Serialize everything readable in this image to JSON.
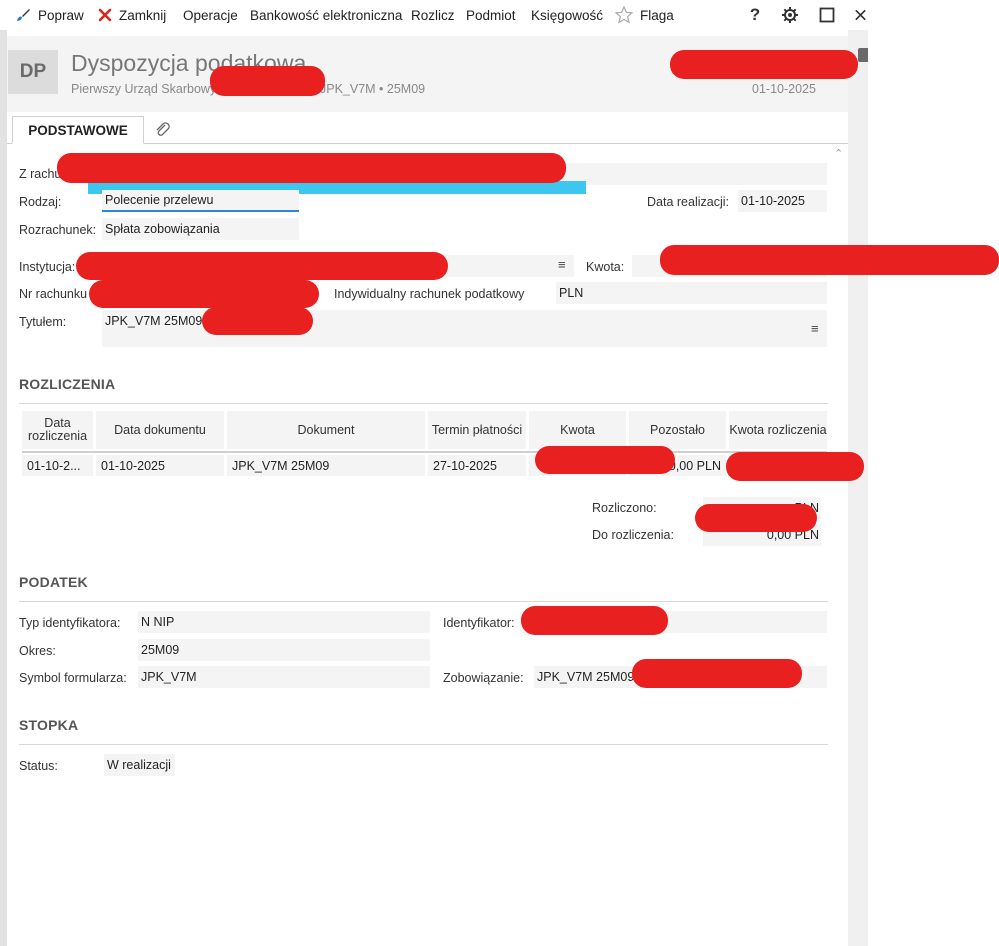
{
  "toolbar": {
    "fix_label": "Popraw",
    "close_label": "Zamknij",
    "operations_label": "Operacje",
    "ebanking_label": "Bankowość elektroniczna",
    "settle_label": "Rozlicz",
    "entity_label": "Podmiot",
    "accounting_label": "Księgowość",
    "flag_label": "Flaga",
    "help_icon": "?",
    "accent_close": "#d9261c"
  },
  "header": {
    "badge": "DP",
    "title": "Dyspozycja podatkowa",
    "subtitle_left": "Pierwszy Urząd Skarbowy",
    "subtitle_mid": "JPK_V7M  •  25M09",
    "date": "01-10-2025"
  },
  "tabs": {
    "basic": "PODSTAWOWE"
  },
  "form": {
    "from_account_label": "Z rachu",
    "type_label": "Rodzaj:",
    "type_value": "Polecenie przelewu",
    "settlement_account_label": "Rozrachunek:",
    "settlement_account_value": "Spłata zobowiązania",
    "exec_date_label": "Data realizacji:",
    "exec_date_value": "01-10-2025",
    "institution_label": "Instytucja:",
    "amount_label": "Kwota:",
    "account_no_label": "Nr rachunku",
    "individual_account": "Indywidualny rachunek podatkowy",
    "currency": "PLN",
    "title_label": "Tytułem:",
    "title_value": "JPK_V7M 25M09"
  },
  "settlements": {
    "section": "ROZLICZENIA",
    "columns": [
      "Data rozliczenia",
      "Data dokumentu",
      "Dokument",
      "Termin płatności",
      "Kwota",
      "Pozostało",
      "Kwota rozliczenia"
    ],
    "row": {
      "settle_date": "01-10-2...",
      "doc_date": "01-10-2025",
      "document": "JPK_V7M 25M09",
      "due_date": "27-10-2025",
      "remaining": "0,00 PLN"
    },
    "settled_label": "Rozliczono:",
    "settled_value": "PLN",
    "to_settle_label": "Do rozliczenia:",
    "to_settle_value": "0,00 PLN"
  },
  "tax": {
    "section": "PODATEK",
    "id_type_label": "Typ identyfikatora:",
    "id_type_value": "N  NIP",
    "identifier_label": "Identyfikator:",
    "period_label": "Okres:",
    "period_value": "25M09",
    "form_symbol_label": "Symbol formularza:",
    "form_symbol_value": "JPK_V7M",
    "liability_label": "Zobowiązanie:",
    "liability_value": "JPK_V7M 25M09"
  },
  "footer": {
    "section": "STOPKA",
    "status_label": "Status:",
    "status_value": "W realizacji"
  }
}
